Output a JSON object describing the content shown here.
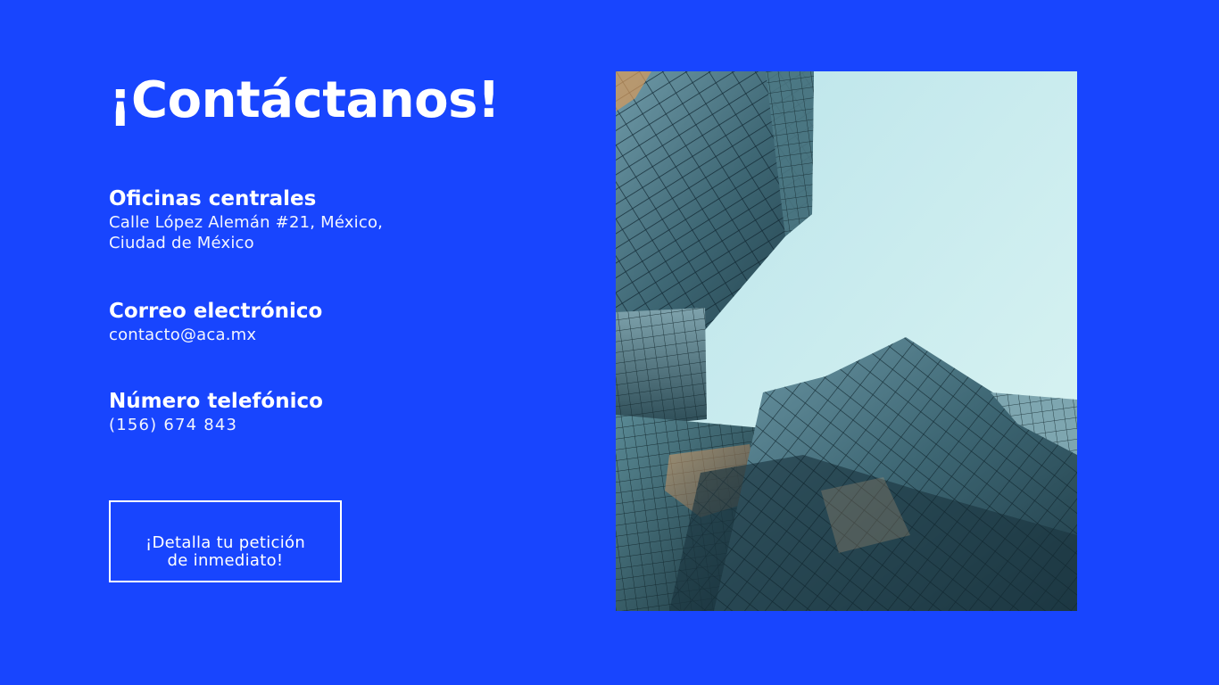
{
  "page": {
    "background_color": "#1845fe",
    "text_color": "#ffffff",
    "title": "¡Contáctanos!"
  },
  "sections": {
    "offices": {
      "heading": "Oficinas centrales",
      "line1": "Calle López Alemán #21, México,",
      "line2": "Ciudad de México"
    },
    "email": {
      "heading": "Correo electrónico",
      "value": "contacto@aca.mx"
    },
    "phone": {
      "heading": "Número telefónico",
      "value": "(156) 674 843"
    }
  },
  "cta_button": {
    "line1": "¡Detalla tu petición",
    "line2": "de inmediato!"
  },
  "photo": {
    "icon": "glass-skyscrapers-photo",
    "sky_color": "#c8ecee",
    "glass_color": "#2f5560"
  }
}
